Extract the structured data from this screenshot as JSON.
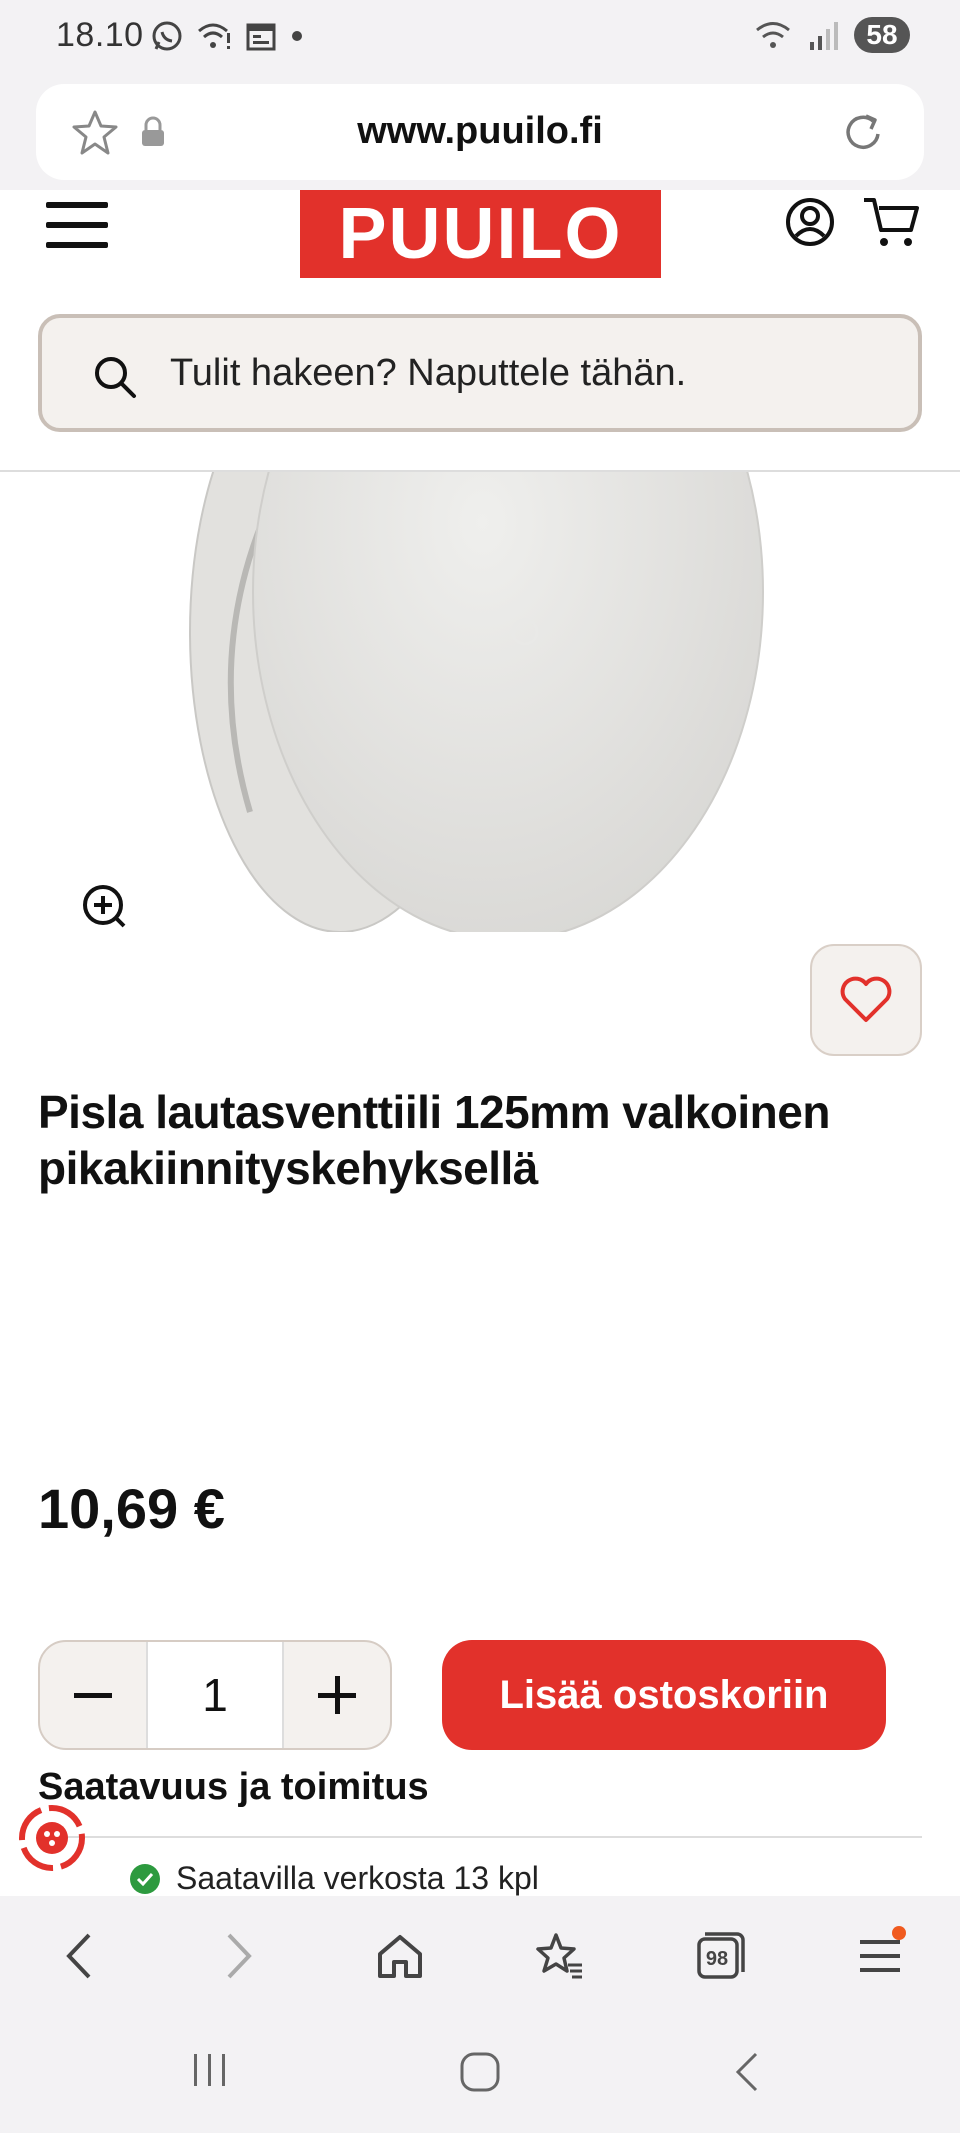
{
  "status_bar": {
    "time": "18.10",
    "battery": "58"
  },
  "browser": {
    "url": "www.puuilo.fi",
    "tabs_count": "98"
  },
  "site": {
    "logo": "PUUILO",
    "search_placeholder": "Tulit hakeen? Naputtele tähän."
  },
  "product": {
    "title": "Pisla lautasventtiili 125mm valkoinen pikakiinnityskehyksellä",
    "price": "10,69 €",
    "quantity": "1",
    "add_to_cart": "Lisää ostoskoriin",
    "availability_title": "Saatavuus ja toimitus",
    "availability_online": "Saatavilla verkosta 13 kpl"
  },
  "colors": {
    "brand": "#e2312b",
    "available": "#2d9a3f"
  }
}
